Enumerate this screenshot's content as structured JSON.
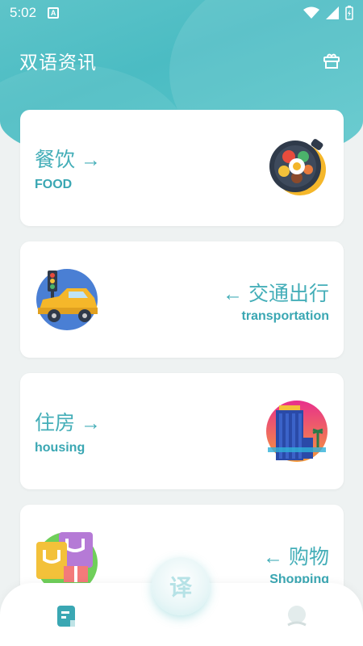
{
  "status": {
    "time": "5:02",
    "notif_letter": "A"
  },
  "app": {
    "title": "双语资讯"
  },
  "cards": [
    {
      "zh": "餐饮",
      "arrow": "→",
      "en": "FOOD"
    },
    {
      "zh": "交通出行",
      "arrow": "←",
      "en": "transportation"
    },
    {
      "zh": "住房",
      "arrow": "→",
      "en": "housing"
    },
    {
      "zh": "购物",
      "arrow": "←",
      "en": "Shopping"
    }
  ],
  "fab": {
    "label": "译"
  },
  "colors": {
    "accent": "#44aeb8",
    "header": "#4bbcc3"
  }
}
